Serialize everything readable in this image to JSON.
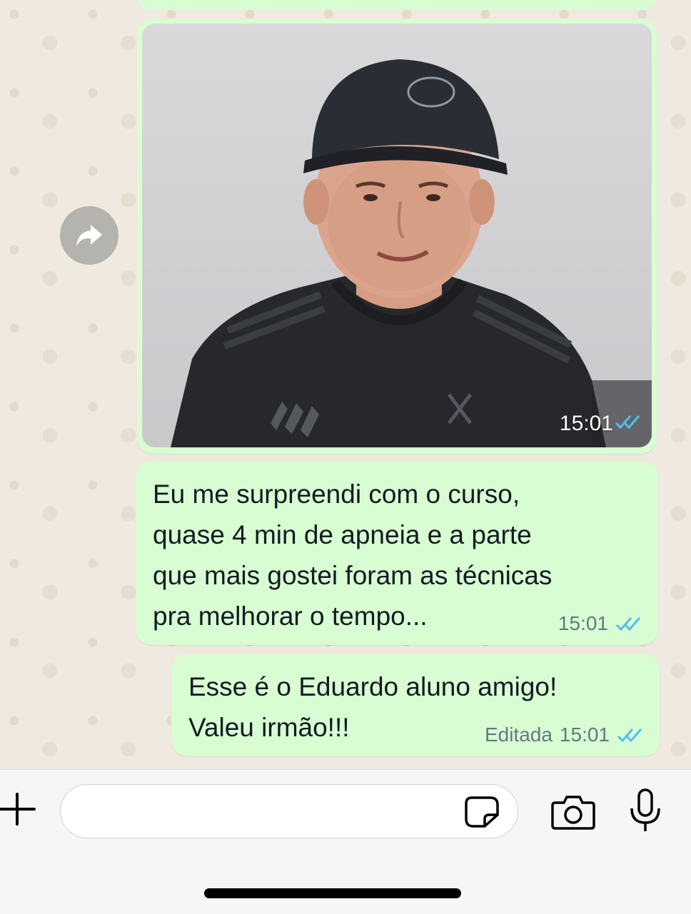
{
  "messages": [
    {
      "type": "video",
      "time": "15:01",
      "status": "read",
      "thumbnail": "man-in-black-cap-and-shirt"
    },
    {
      "type": "text",
      "text": "Eu me surpreendi com o curso,\nquase 4 min de apneia e a parte\nque mais gostei foram as técnicas\npra melhorar o tempo...",
      "time": "15:01",
      "status": "read"
    },
    {
      "type": "text",
      "text": "Esse é o Eduardo aluno amigo!\nValeu irmão!!!",
      "edited_label": "Editada",
      "time": "15:01",
      "status": "read"
    }
  ],
  "colors": {
    "outgoing_bubble": "#d9fdd3",
    "read_ticks": "#53bdeb",
    "chat_background": "#efe9df"
  },
  "icons": {
    "forward": "forward-arrow-icon",
    "attach": "plus-icon",
    "sticker": "sticker-icon",
    "camera": "camera-icon",
    "mic": "microphone-icon"
  },
  "composer": {
    "value": "",
    "placeholder": ""
  }
}
